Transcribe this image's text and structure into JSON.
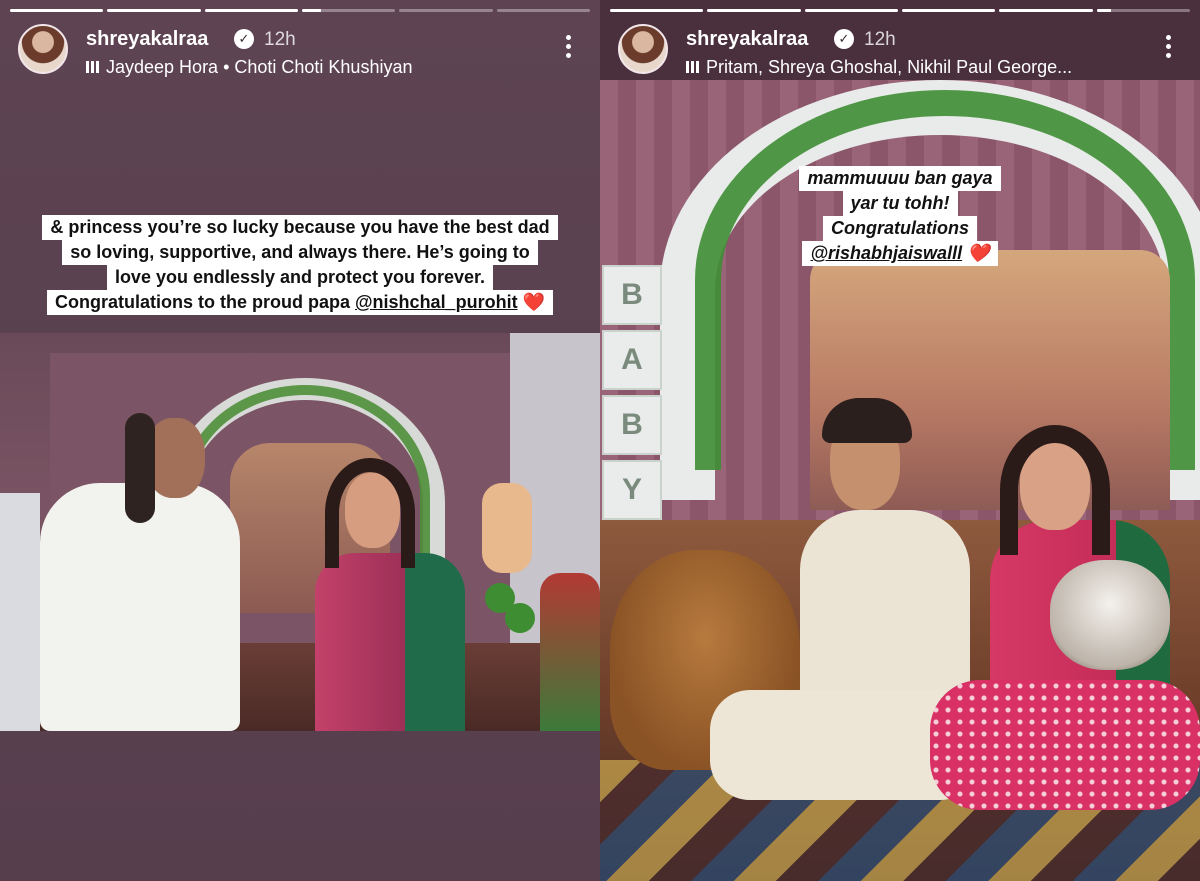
{
  "stories": [
    {
      "username": "shreyakalraa",
      "time": "12h",
      "music": "Jaydeep Hora • Choti Choti Khushiyan",
      "progress": [
        1,
        1,
        1,
        0.2,
        0,
        0
      ],
      "caption": [
        "& princess you’re so lucky because you have the best dad",
        "so loving, supportive, and always there. He’s going to",
        "love you endlessly and protect you forever."
      ],
      "caption_last": "Congratulations to the proud papa",
      "mention": "@nishchal_purohit",
      "heart": "❤️"
    },
    {
      "username": "shreyakalraa",
      "time": "12h",
      "music": "Pritam, Shreya Ghoshal, Nikhil Paul George...",
      "progress": [
        1,
        1,
        1,
        1,
        1,
        0.15
      ],
      "caption": [
        "mammuuuu ban gaya",
        "yar tu tohh!",
        "Congratulations"
      ],
      "mention": "@rishabhjaiswalll",
      "heart": "❤️"
    }
  ],
  "colors": {
    "heart": "#e11d2e",
    "sticker_bg": "#ffffff"
  },
  "icons": [
    "verified-badge-icon",
    "music-bars-icon",
    "more-options-icon"
  ]
}
